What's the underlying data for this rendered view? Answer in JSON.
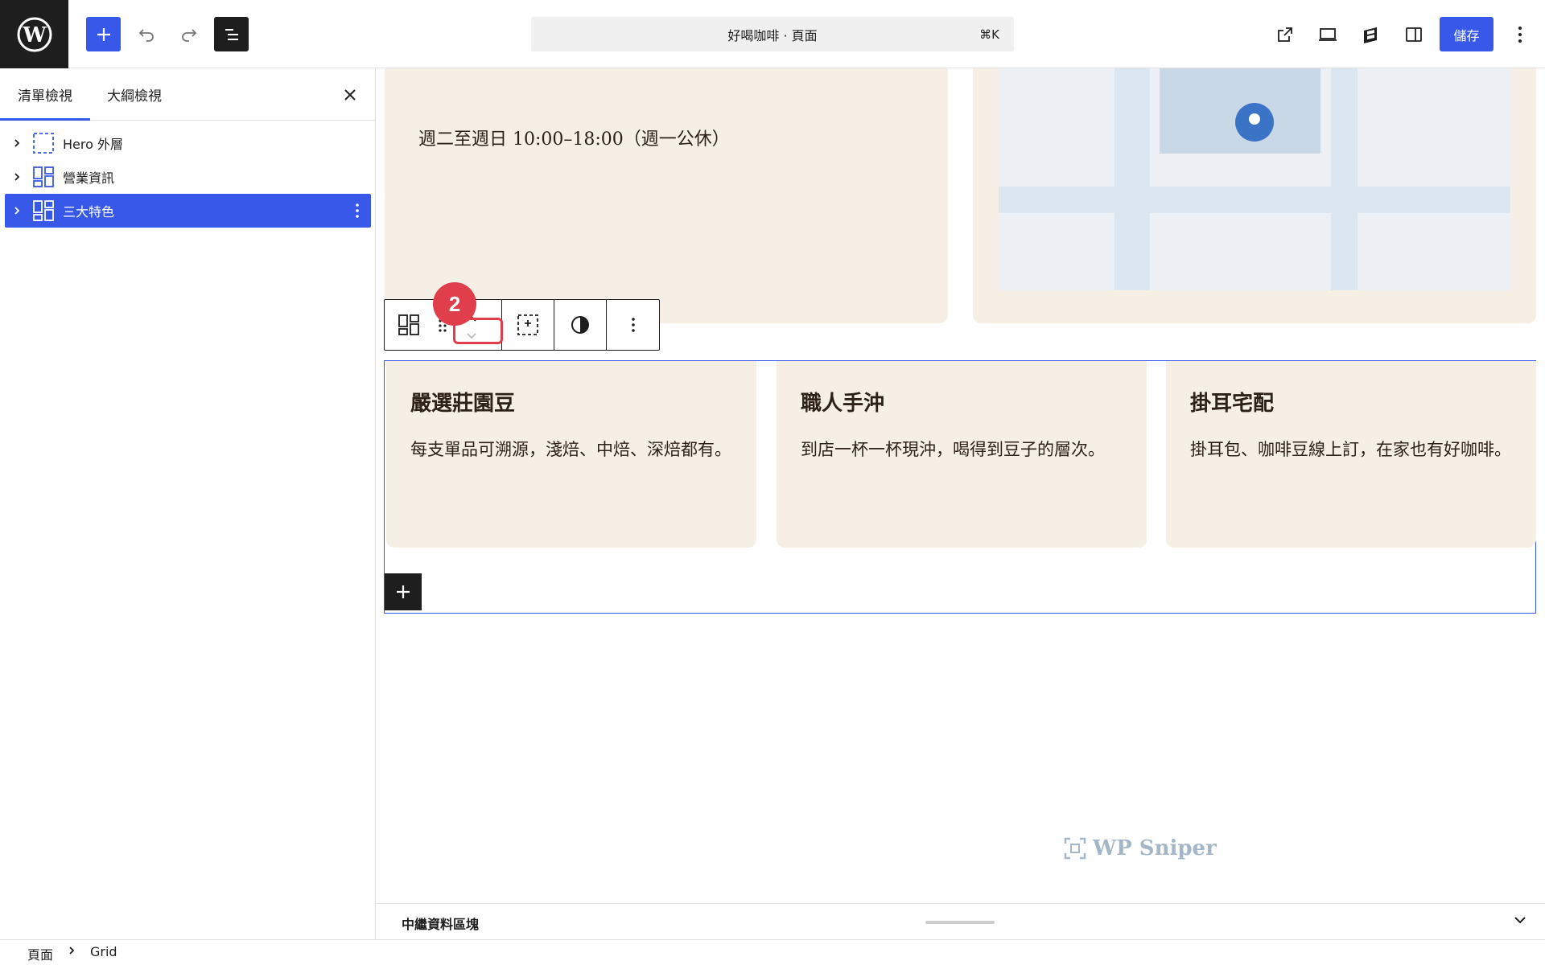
{
  "topbar": {
    "document_title": "好喝咖啡 · 頁面",
    "shortcut": "⌘K",
    "save_label": "儲存"
  },
  "sidebar": {
    "tabs": [
      {
        "label": "清單檢視",
        "active": true
      },
      {
        "label": "大綱檢視",
        "active": false
      }
    ],
    "tree": [
      {
        "label": "Hero 外層",
        "icon": "group-icon",
        "selected": false
      },
      {
        "label": "營業資訊",
        "icon": "grid-icon",
        "selected": false
      },
      {
        "label": "三大特色",
        "icon": "grid-icon",
        "selected": true
      }
    ]
  },
  "canvas": {
    "hours_text": "週二至週日 10:00–18:00（週一公休）",
    "step_badge": "2",
    "features": [
      {
        "title": "嚴選莊園豆",
        "desc": "每支單品可溯源，淺焙、中焙、深焙都有。"
      },
      {
        "title": "職人手沖",
        "desc": "到店一杯一杯現沖，喝得到豆子的層次。"
      },
      {
        "title": "掛耳宅配",
        "desc": "掛耳包、咖啡豆線上訂，在家也有好咖啡。"
      }
    ],
    "watermark": "WP Sniper"
  },
  "meta_panel": {
    "label": "中繼資料區塊"
  },
  "breadcrumb": {
    "items": [
      "頁面",
      "Grid"
    ]
  },
  "colors": {
    "accent": "#3858e9",
    "card_bg": "#f6efe6",
    "badge": "#e03e4a",
    "dark": "#1e1e1e"
  }
}
